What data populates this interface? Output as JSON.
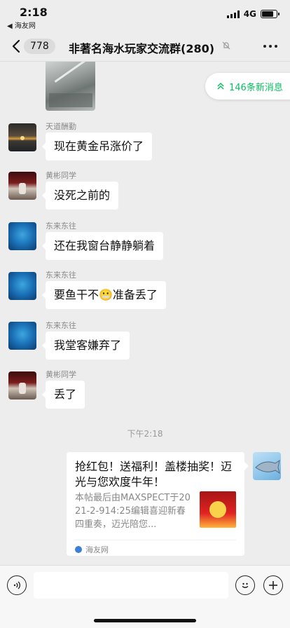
{
  "status": {
    "time": "2:18",
    "back_app": "◀ 海友网",
    "network": "4G"
  },
  "nav": {
    "back_count": "778",
    "title": "非著名海水玩家交流群(280)"
  },
  "new_messages": {
    "label": "146条新消息"
  },
  "messages": [
    {
      "sender": "天道酬勤",
      "text": "现在黄金吊涨价了"
    },
    {
      "sender": "黄彬同学",
      "text": "没死之前的"
    },
    {
      "sender": "东来东往",
      "text": "还在我窗台静静躺着"
    },
    {
      "sender": "东来东往",
      "text": "要鱼干不😬准备丢了"
    },
    {
      "sender": "东来东往",
      "text": "我堂客嫌弃了"
    },
    {
      "sender": "黄彬同学",
      "text": "丢了"
    }
  ],
  "timestamp": "下午2:18",
  "share_card": {
    "title": "抢红包！送福利！盖楼抽奖！迈光与您欢度牛年！",
    "description": "本帖最后由MAXSPECT于2021-2-914:25编辑喜迎新春四重奏，迈光陪您...",
    "source": "海友网"
  }
}
